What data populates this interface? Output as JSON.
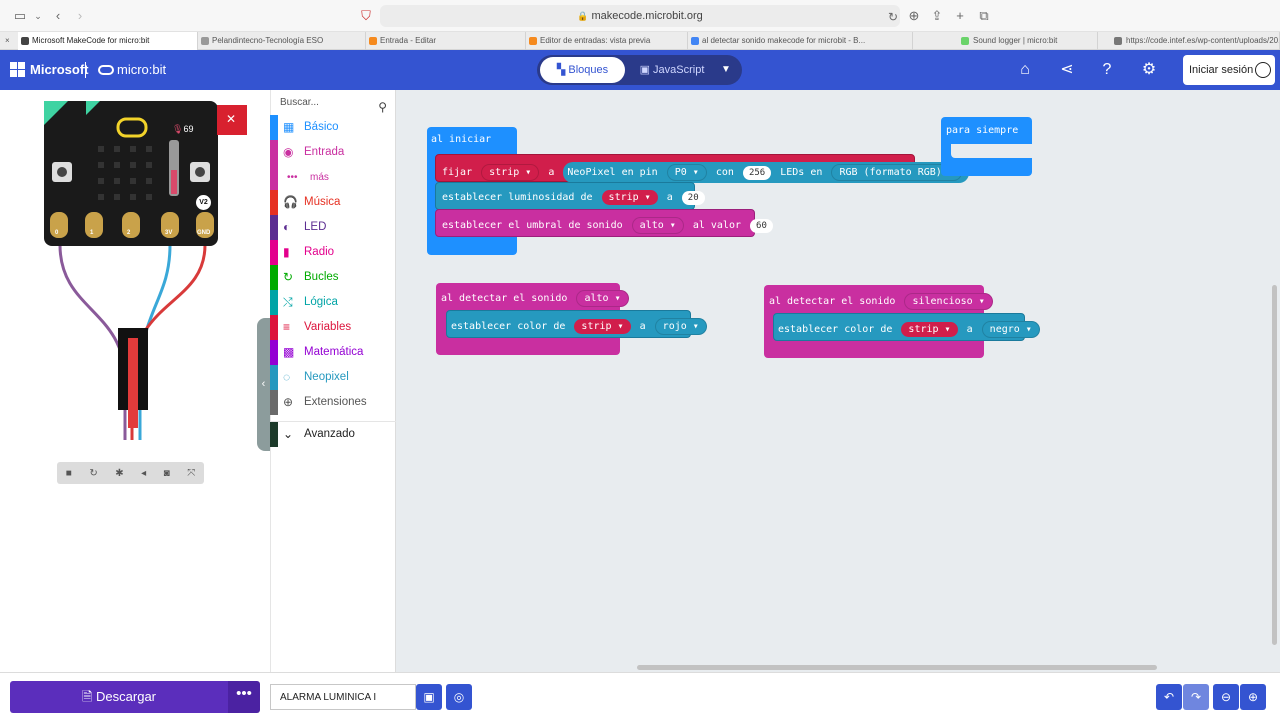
{
  "browser": {
    "url": "makecode.microbit.org",
    "tabs": [
      {
        "title": "Microsoft MakeCode for micro:bit",
        "active": true
      },
      {
        "title": "Pelandintecno-Tecnología ESO"
      },
      {
        "title": "Entrada - Editar"
      },
      {
        "title": "Editor de entradas: vista previa"
      },
      {
        "title": "al detectar sonido makecode for microbit - B..."
      },
      {
        "title": "Sound logger | micro:bit"
      },
      {
        "title": "https://code.intef.es/wp-content/uploads/20..."
      }
    ]
  },
  "header": {
    "ms_logo": "Microsoft",
    "mb_logo": "micro:bit",
    "mode_blocks": "Bloques",
    "mode_js": "JavaScript",
    "signin": "Iniciar sesión",
    "colors": {
      "header": "#3454d1",
      "download": "#5b2ebc"
    }
  },
  "simulator": {
    "sound_level": "69",
    "pins": [
      "0",
      "1",
      "2",
      "3V",
      "GND"
    ],
    "badge": "V2",
    "controls": [
      "stop-icon",
      "restart-icon",
      "debug-icon",
      "mute-icon",
      "screenshot-icon",
      "fullscreen-icon"
    ]
  },
  "toolbox": {
    "search_placeholder": "Buscar...",
    "categories": [
      {
        "label": "Básico",
        "color": "#1e90ff",
        "icon": "grid-icon"
      },
      {
        "label": "Entrada",
        "color": "#c92fa0",
        "icon": "target-icon"
      },
      {
        "label": "más",
        "color": "#c92fa0",
        "icon": "dots-icon"
      },
      {
        "label": "Música",
        "color": "#e63022",
        "icon": "headphones-icon"
      },
      {
        "label": "LED",
        "color": "#5c2d91",
        "icon": "toggle-icon"
      },
      {
        "label": "Radio",
        "color": "#e3008c",
        "icon": "signal-icon"
      },
      {
        "label": "Bucles",
        "color": "#00aa00",
        "icon": "loop-icon"
      },
      {
        "label": "Lógica",
        "color": "#00a4a6",
        "icon": "shuffle-icon"
      },
      {
        "label": "Variables",
        "color": "#dc143c",
        "icon": "list-icon"
      },
      {
        "label": "Matemática",
        "color": "#9400d3",
        "icon": "calculator-icon"
      },
      {
        "label": "Neopixel",
        "color": "#2699bf",
        "icon": "dotcircle-icon"
      },
      {
        "label": "Extensiones",
        "color": "#6a6a6a",
        "icon": "plus-circle-icon"
      },
      {
        "label": "Avanzado",
        "color": "#222222",
        "icon": "chevron-down-icon"
      }
    ]
  },
  "blocks": {
    "on_start": "al iniciar",
    "set_strip": {
      "fijar": "fijar",
      "var": "strip",
      "a": "a",
      "neopixel": "NeoPixel en pin",
      "pin": "P0",
      "con": "con",
      "count": "256",
      "leds": "LEDs en",
      "mode": "RGB (formato RGB)"
    },
    "brightness": {
      "label": "establecer luminosidad de",
      "var": "strip",
      "a": "a",
      "value": "20"
    },
    "threshold": {
      "label": "establecer el umbral de sonido",
      "level": "alto",
      "al_valor": "al valor",
      "value": "60"
    },
    "forever": "para siempre",
    "loud": {
      "label": "al detectar el sonido",
      "level": "alto",
      "set_color": "establecer color de",
      "var": "strip",
      "a": "a",
      "color": "rojo"
    },
    "quiet": {
      "label": "al detectar el sonido",
      "level": "silencioso",
      "set_color": "establecer color de",
      "var": "strip",
      "a": "a",
      "color": "negro"
    }
  },
  "bottom": {
    "download": "Descargar",
    "more": "•••",
    "project_name": "ALARMA LUMÍNICA I"
  }
}
